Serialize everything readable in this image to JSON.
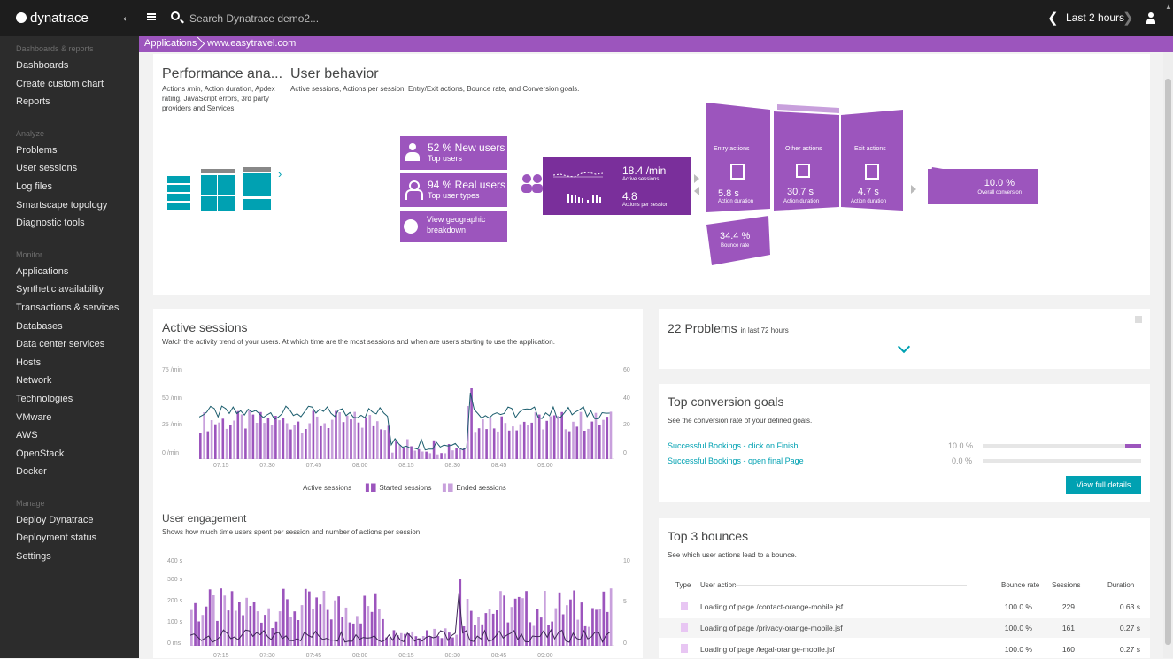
{
  "topbar": {
    "logo": "dynatrace",
    "search_placeholder": "Search Dynatrace demo2...",
    "timeframe": "Last 2 hours"
  },
  "sidebar": {
    "sections": [
      {
        "title": "Dashboards & reports",
        "items": [
          "Dashboards",
          "Create custom chart",
          "Reports"
        ]
      },
      {
        "title": "Analyze",
        "items": [
          "Problems",
          "User sessions",
          "Log files",
          "Smartscape topology",
          "Diagnostic tools"
        ]
      },
      {
        "title": "Monitor",
        "items": [
          "Applications",
          "Synthetic availability",
          "Transactions & services",
          "Databases",
          "Data center services",
          "Hosts",
          "Network",
          "Technologies",
          "VMware",
          "AWS",
          "OpenStack",
          "Docker"
        ]
      },
      {
        "title": "Manage",
        "items": [
          "Deploy Dynatrace",
          "Deployment status",
          "Settings"
        ]
      }
    ]
  },
  "breadcrumb": {
    "root": "Applications",
    "current": "www.easytravel.com"
  },
  "performance": {
    "title": "Performance ana...",
    "desc": "Actions /min, Action duration, Apdex rating, JavaScript errors, 3rd party providers and Services."
  },
  "user_behavior": {
    "title": "User behavior",
    "desc": "Active sessions, Actions per session, Entry/Exit actions, Bounce rate, and Conversion goals.",
    "new_users": "52 % New users",
    "top_users": "Top users",
    "real_users": "94 % Real users",
    "top_user_types": "Top user types",
    "geo_line1": "View geographic",
    "geo_line2": "breakdown",
    "active_sessions_val": "18.4 /min",
    "active_sessions_lbl": "Active sessions",
    "actions_per_session_val": "4.8",
    "actions_per_session_lbl": "Actions per session",
    "entry_label": "Entry actions",
    "entry_val": "5.8 s",
    "other_label": "Other actions",
    "other_val": "30.7 s",
    "exit_label": "Exit actions",
    "exit_val": "4.7 s",
    "duration_lbl": "Action duration",
    "bounce_val": "34.4 %",
    "bounce_lbl": "Bounce rate",
    "conversion_val": "10.0 %",
    "conversion_lbl": "Overall conversion"
  },
  "active_sessions": {
    "title": "Active sessions",
    "desc": "Watch the activity trend of your users. At which time are the most sessions and when are users starting to use the application.",
    "y_left": [
      "75 /min",
      "50 /min",
      "25 /min",
      "0 /min"
    ],
    "y_right": [
      "60",
      "40",
      "20",
      "0"
    ],
    "x": [
      "07:15",
      "07:30",
      "07:45",
      "08:00",
      "08:15",
      "08:30",
      "08:45",
      "09:00"
    ],
    "legend_active": "Active sessions",
    "legend_started": "Started sessions",
    "legend_ended": "Ended sessions"
  },
  "engagement": {
    "title": "User engagement",
    "desc": "Shows how much time users spent per session and number of actions per session.",
    "y_left": [
      "400 s",
      "300 s",
      "200 s",
      "100 s",
      "0 ms"
    ],
    "y_right": [
      "10",
      "5",
      "0"
    ],
    "x": [
      "07:15",
      "07:30",
      "07:45",
      "08:00",
      "08:15",
      "08:30",
      "08:45",
      "09:00"
    ]
  },
  "problems": {
    "count_title": "22 Problems",
    "suffix": "in last 72 hours"
  },
  "conversion": {
    "title": "Top conversion goals",
    "desc": "See the conversion rate of your defined goals.",
    "goals": [
      {
        "name": "Successful Bookings - click on Finish",
        "value": "10.0 %",
        "rate": 0.1
      },
      {
        "name": "Successful Bookings - open final Page",
        "value": "0.0 %",
        "rate": 0.0
      }
    ],
    "button": "View full details"
  },
  "bounces": {
    "title": "Top 3 bounces",
    "desc": "See which user actions lead to a bounce.",
    "headers": {
      "type": "Type",
      "action": "User action",
      "rate": "Bounce rate",
      "sessions": "Sessions",
      "duration": "Duration"
    },
    "rows": [
      {
        "action": "Loading of page /contact-orange-mobile.jsf",
        "rate": "100.0 %",
        "sessions": "229",
        "duration": "0.63 s"
      },
      {
        "action": "Loading of page /privacy-orange-mobile.jsf",
        "rate": "100.0 %",
        "sessions": "161",
        "duration": "0.27 s"
      },
      {
        "action": "Loading of page /legal-orange-mobile.jsf",
        "rate": "100.0 %",
        "sessions": "160",
        "duration": "0.27 s"
      }
    ]
  },
  "colors": {
    "accent": "#9c55bd",
    "teal": "#00a1b2",
    "dark": "#1d1d1d",
    "sidebar": "#2c2c2c"
  }
}
